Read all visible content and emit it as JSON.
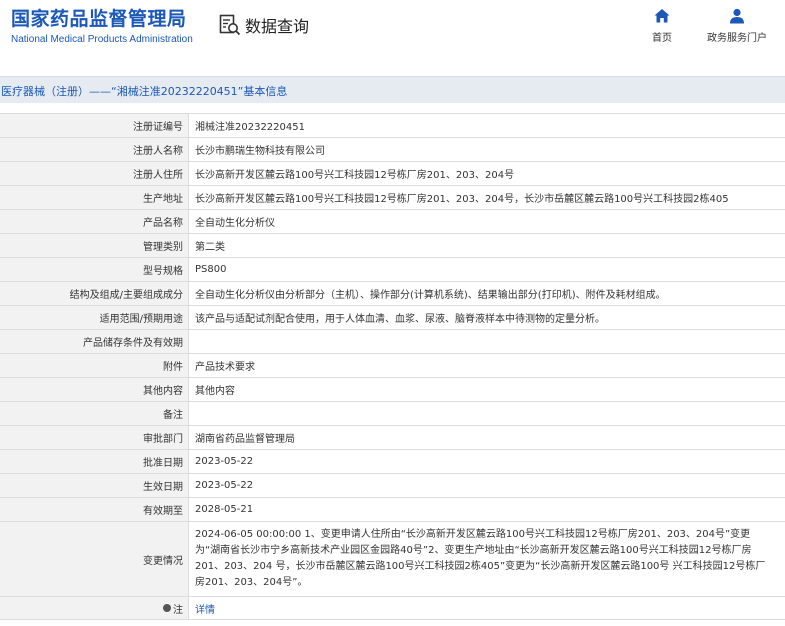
{
  "header": {
    "brand_cn": "国家药品监督管理局",
    "brand_en": "National Medical Products Administration",
    "data_query": "数据查询",
    "nav": [
      {
        "label": "首页",
        "icon": "home-icon"
      },
      {
        "label": "政务服务门户",
        "icon": "user-icon"
      }
    ]
  },
  "title": "医疗器械（注册）——“湘械注准20232220451”基本信息",
  "rows": [
    {
      "label": "注册证编号",
      "value": "湘械注准20232220451"
    },
    {
      "label": "注册人名称",
      "value": "长沙市鹏瑞生物科技有限公司"
    },
    {
      "label": "注册人住所",
      "value": "长沙高新开发区麓云路100号兴工科技园12号栋厂房201、203、204号"
    },
    {
      "label": "生产地址",
      "value": "长沙高新开发区麓云路100号兴工科技园12号栋厂房201、203、204号，长沙市岳麓区麓云路100号兴工科技园2栋405"
    },
    {
      "label": "产品名称",
      "value": "全自动生化分析仪"
    },
    {
      "label": "管理类别",
      "value": "第二类"
    },
    {
      "label": "型号规格",
      "value": "PS800"
    },
    {
      "label": "结构及组成/主要组成成分",
      "value": "全自动生化分析仪由分析部分（主机）、操作部分(计算机系统)、结果输出部分(打印机)、附件及耗材组成。"
    },
    {
      "label": "适用范围/预期用途",
      "value": "该产品与适配试剂配合使用，用于人体血清、血浆、尿液、脑脊液样本中待测物的定量分析。"
    },
    {
      "label": "产品储存条件及有效期",
      "value": ""
    },
    {
      "label": "附件",
      "value": "产品技术要求"
    },
    {
      "label": "其他内容",
      "value": "其他内容"
    },
    {
      "label": "备注",
      "value": ""
    },
    {
      "label": "审批部门",
      "value": "湖南省药品监督管理局"
    },
    {
      "label": "批准日期",
      "value": "2023-05-22"
    },
    {
      "label": "生效日期",
      "value": "2023-05-22"
    },
    {
      "label": "有效期至",
      "value": "2028-05-21"
    }
  ],
  "change": {
    "label": "变更情况",
    "value": "2024-06-05 00:00:00 1、变更申请人住所由“长沙高新开发区麓云路100号兴工科技园12号栋厂房201、203、204号”变更为“湖南省长沙市宁乡高新技术产业园区金园路40号”2、变更生产地址由“长沙高新开发区麓云路100号兴工科技园12号栋厂房201、203、204 号，长沙市岳麓区麓云路100号兴工科技园2栋405”变更为“长沙高新开发区麓云路100号 兴工科技园12号栋厂房201、203、204号”。"
  },
  "note": {
    "label": "注",
    "link": "详情",
    "icon": "note-dot-icon"
  },
  "colors": {
    "brand": "#1b58b8",
    "titlebar_bg": "#e6ebf2",
    "label_bg": "#f2f2f2",
    "border": "#dcdcdc"
  }
}
